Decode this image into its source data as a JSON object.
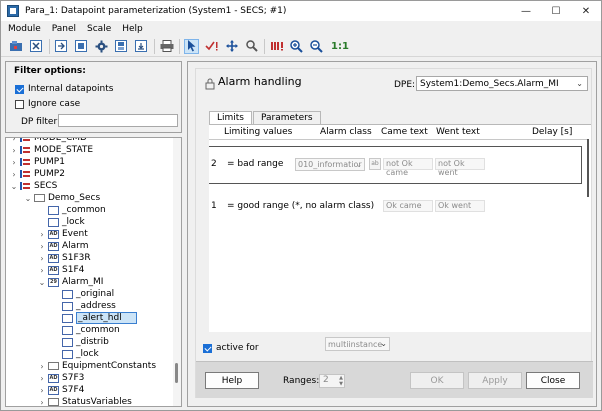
{
  "window": {
    "title": "Para_1: Datapoint parameterization (System1 - SECS; #1)",
    "controls": {
      "minimize": "—",
      "maximize": "☐",
      "close": "✕"
    }
  },
  "menu": [
    "Module",
    "Panel",
    "Scale",
    "Help"
  ],
  "toolbar": {
    "icons": [
      "open-icon",
      "close-panel-icon",
      "import-icon",
      "export-icon",
      "settings-icon",
      "save-icon",
      "save-all-icon",
      "print-icon",
      "select-cursor-icon",
      "check-icon",
      "move-icon",
      "search-icon",
      "alarm-icon",
      "zoom-in-icon",
      "zoom-out-icon"
    ],
    "zoom_reset_label": "1:1"
  },
  "filter": {
    "title": "Filter options:",
    "internal_datapoints": {
      "label": "Internal datapoints",
      "checked": true
    },
    "ignore_case": {
      "label": "Ignore case",
      "checked": false
    },
    "dp_filter_label": "DP filter:",
    "dp_filter_value": ""
  },
  "tree": {
    "items": [
      {
        "label": "MODE_CMD",
        "indent": 0,
        "chev": "›",
        "icon": "struct"
      },
      {
        "label": "MODE_STATE",
        "indent": 0,
        "chev": "›",
        "icon": "struct"
      },
      {
        "label": "PUMP1",
        "indent": 0,
        "chev": "›",
        "icon": "struct"
      },
      {
        "label": "PUMP2",
        "indent": 0,
        "chev": "›",
        "icon": "struct"
      },
      {
        "label": "SECS",
        "indent": 0,
        "chev": "⌄",
        "icon": "struct"
      },
      {
        "label": "Demo_Secs",
        "indent": 1,
        "chev": "⌄",
        "icon": "folder"
      },
      {
        "label": "_common",
        "indent": 2,
        "chev": "",
        "icon": "cfg"
      },
      {
        "label": "_lock",
        "indent": 2,
        "chev": "",
        "icon": "cfg"
      },
      {
        "label": "Event",
        "indent": 2,
        "chev": "›",
        "icon": "ad",
        "icon_text": "AD"
      },
      {
        "label": "Alarm",
        "indent": 2,
        "chev": "›",
        "icon": "ad",
        "icon_text": "AD"
      },
      {
        "label": "S1F3R",
        "indent": 2,
        "chev": "›",
        "icon": "ad",
        "icon_text": "AD"
      },
      {
        "label": "S1F4",
        "indent": 2,
        "chev": "›",
        "icon": "ad",
        "icon_text": "AD"
      },
      {
        "label": "Alarm_MI",
        "indent": 2,
        "chev": "⌄",
        "icon": "ad",
        "icon_text": "29"
      },
      {
        "label": "_original",
        "indent": 3,
        "chev": "",
        "icon": "cfg"
      },
      {
        "label": "_address",
        "indent": 3,
        "chev": "",
        "icon": "cfg"
      },
      {
        "label": "_alert_hdl",
        "indent": 3,
        "chev": "",
        "icon": "cfg",
        "selected": true
      },
      {
        "label": "_common",
        "indent": 3,
        "chev": "",
        "icon": "cfg"
      },
      {
        "label": "_distrib",
        "indent": 3,
        "chev": "",
        "icon": "cfg"
      },
      {
        "label": "_lock",
        "indent": 3,
        "chev": "",
        "icon": "cfg"
      },
      {
        "label": "EquipmentConstants",
        "indent": 2,
        "chev": "›",
        "icon": "folder"
      },
      {
        "label": "S7F3",
        "indent": 2,
        "chev": "›",
        "icon": "ad",
        "icon_text": "AD"
      },
      {
        "label": "S7F4",
        "indent": 2,
        "chev": "›",
        "icon": "ad",
        "icon_text": "AD"
      },
      {
        "label": "StatusVariables",
        "indent": 2,
        "chev": "›",
        "icon": "folder"
      }
    ]
  },
  "alarm": {
    "title": "Alarm handling",
    "dpe_label": "DPE:",
    "dpe_value": "System1:Demo_Secs.Alarm_MI",
    "tabs": [
      {
        "label": "Limits",
        "active": true
      },
      {
        "label": "Parameters",
        "active": false
      }
    ],
    "columns": {
      "limiting_values": "Limiting values",
      "alarm_class": "Alarm class",
      "came_text": "Came text",
      "went_text": "Went text",
      "delay": "Delay [s]"
    },
    "ranges": [
      {
        "num": "2",
        "cond": "= bad range",
        "alarm_class": "010_informatior",
        "btn": "ab",
        "came": "not Ok came",
        "went": "not Ok went"
      },
      {
        "num": "1",
        "cond": "= good range (*, no alarm class)",
        "came": "Ok came",
        "went": "Ok went"
      }
    ],
    "active_for": {
      "label": "active for",
      "checked": true,
      "value": "multiinstance"
    },
    "buttons": {
      "help": "Help",
      "ranges_label": "Ranges:",
      "ranges_value": "2",
      "ok": "OK",
      "apply": "Apply",
      "close": "Close"
    }
  }
}
